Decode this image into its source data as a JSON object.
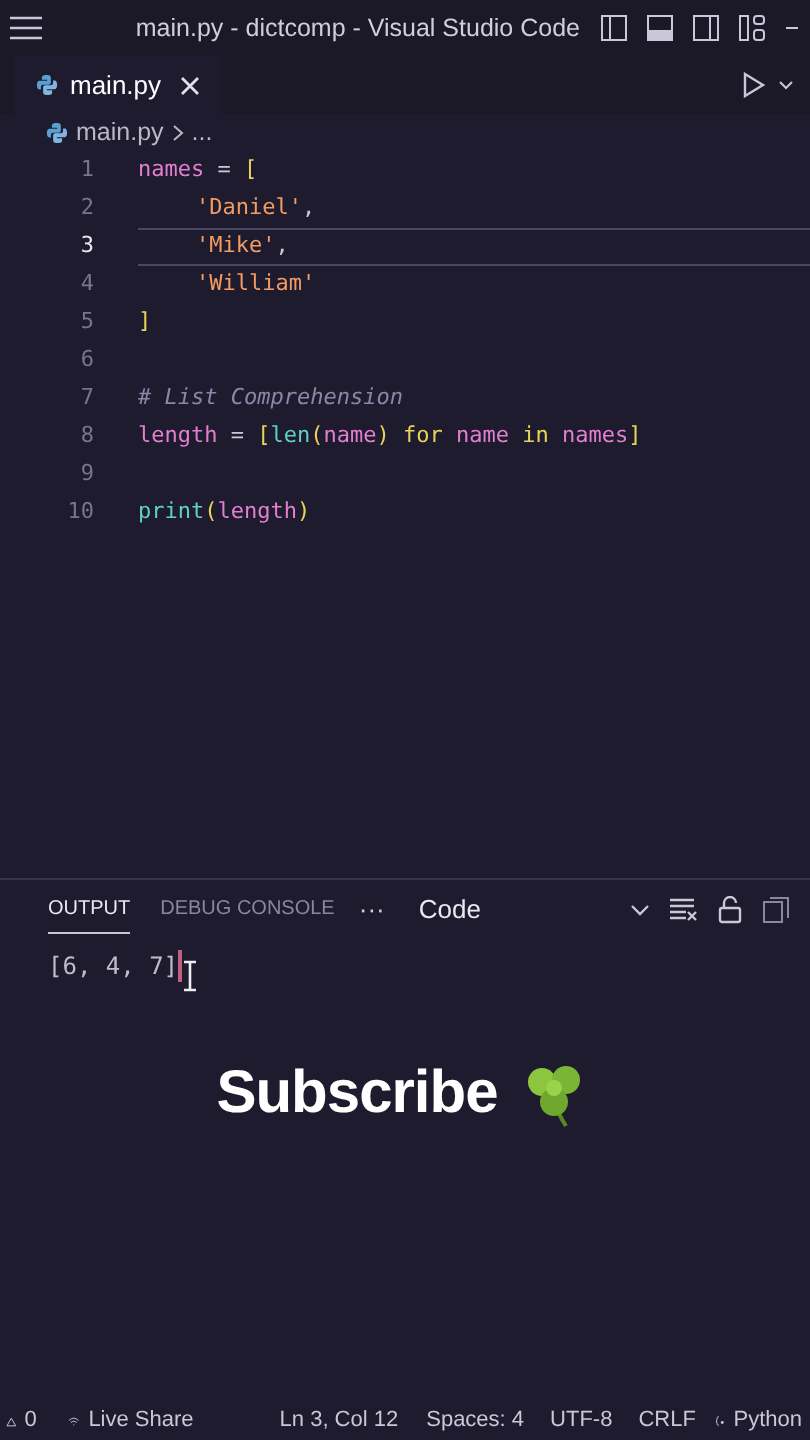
{
  "window": {
    "title": "main.py - dictcomp - Visual Studio Code"
  },
  "tabs": [
    {
      "label": "main.py",
      "selected": true
    }
  ],
  "breadcrumb": [
    "main.py",
    "..."
  ],
  "editor": {
    "lines": [
      {
        "number": "1",
        "current": false,
        "tokens": [
          {
            "kind": "var",
            "text": "names"
          },
          {
            "kind": "op",
            "text": " = "
          },
          {
            "kind": "bracket",
            "text": "["
          }
        ]
      },
      {
        "number": "2",
        "current": false,
        "indented": true,
        "tokens": [
          {
            "kind": "string",
            "text": "'Daniel'"
          },
          {
            "kind": "op",
            "text": ","
          }
        ]
      },
      {
        "number": "3",
        "current": true,
        "indented": true,
        "tokens": [
          {
            "kind": "string",
            "text": "'Mike'"
          },
          {
            "kind": "op",
            "text": ","
          }
        ]
      },
      {
        "number": "4",
        "current": false,
        "indented": true,
        "tokens": [
          {
            "kind": "string",
            "text": "'William'"
          }
        ]
      },
      {
        "number": "5",
        "current": false,
        "tokens": [
          {
            "kind": "bracket",
            "text": "]"
          }
        ]
      },
      {
        "number": "6",
        "current": false
      },
      {
        "number": "7",
        "current": false,
        "tokens": [
          {
            "kind": "comment",
            "text": "# List Comprehension"
          }
        ]
      },
      {
        "number": "8",
        "current": false,
        "tokens": [
          {
            "kind": "var",
            "text": "length"
          },
          {
            "kind": "op",
            "text": " = "
          },
          {
            "kind": "bracket",
            "text": "["
          },
          {
            "kind": "func",
            "text": "len"
          },
          {
            "kind": "paren",
            "text": "("
          },
          {
            "kind": "var",
            "text": "name"
          },
          {
            "kind": "paren",
            "text": ")"
          },
          {
            "kind": "keyword",
            "text": " for"
          },
          {
            "kind": "var",
            "text": " name"
          },
          {
            "kind": "keyword",
            "text": " in"
          },
          {
            "kind": "var",
            "text": " names"
          },
          {
            "kind": "bracket",
            "text": "]"
          }
        ]
      },
      {
        "number": "9",
        "current": false
      },
      {
        "number": "10",
        "current": false,
        "tokens": [
          {
            "kind": "func",
            "text": "print"
          },
          {
            "kind": "paren",
            "text": "("
          },
          {
            "kind": "var",
            "text": "length"
          },
          {
            "kind": "paren",
            "text": ")"
          }
        ]
      }
    ]
  },
  "panel": {
    "tabs": [
      {
        "label": "OUTPUT",
        "selected": true
      },
      {
        "label": "DEBUG CONSOLE",
        "selected": false
      }
    ],
    "more": "···",
    "channel": "Code",
    "output": "[6, 4, 7]"
  },
  "overlay": {
    "text": "Subscribe"
  },
  "status_bar": {
    "problems": "0",
    "live_share": "Live Share",
    "position": "Ln 3, Col 12",
    "spaces": "Spaces: 4",
    "encoding": "UTF-8",
    "eol": "CRLF",
    "language": "Python"
  }
}
